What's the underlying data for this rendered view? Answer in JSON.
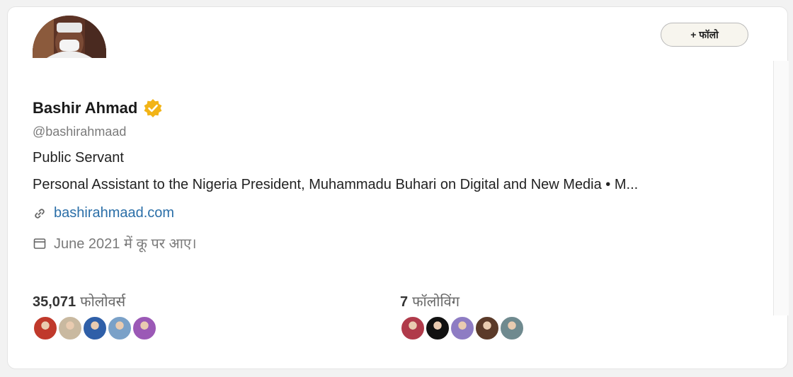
{
  "profile": {
    "name": "Bashir Ahmad",
    "handle": "@bashirahmaad",
    "tagline": "Public Servant",
    "bio": "Personal Assistant to the Nigeria President, Muhammadu Buhari on Digital and New Media • M...",
    "website": "bashirahmaad.com",
    "joined": "June 2021 में कू पर आए।",
    "verified": true
  },
  "follow_button": {
    "label": "+ फॉलो"
  },
  "stats": {
    "followers": {
      "count": "35,071",
      "label": "फोलोवर्स"
    },
    "following": {
      "count": "7",
      "label": "फॉलोविंग"
    }
  },
  "colors": {
    "verified_badge": "#f2b417",
    "link": "#2b6fa8",
    "follower_avatars": [
      "#c0392b",
      "#c9b9a0",
      "#2f5fa8",
      "#7aa1c8",
      "#9b59b6"
    ],
    "following_avatars": [
      "#b03a4a",
      "#111111",
      "#8e7cc3",
      "#5b3a29",
      "#6f8a8f"
    ]
  },
  "icons": {
    "verified": "verified-badge-icon",
    "link": "link-icon",
    "calendar": "calendar-icon"
  }
}
